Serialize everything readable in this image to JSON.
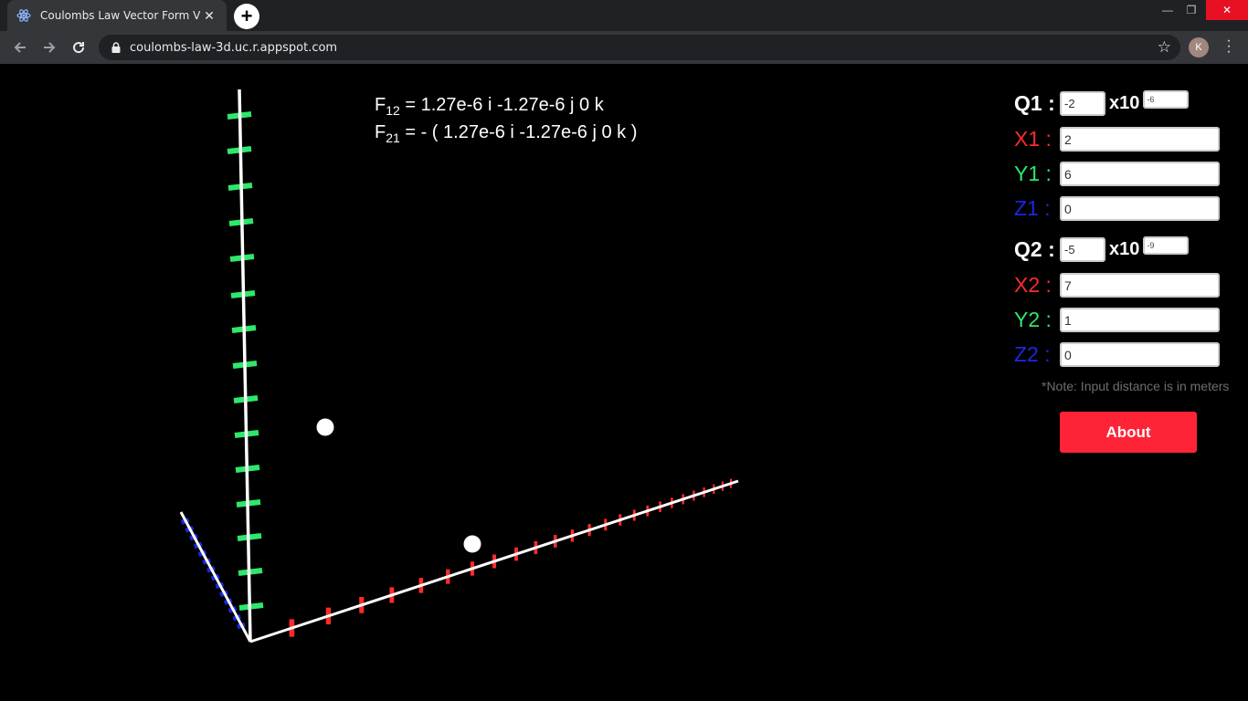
{
  "browser": {
    "tab_title": "Coulombs Law Vector Form Visua",
    "tab_close": "✕",
    "new_tab": "+",
    "url": "coulombs-law-3d.uc.r.appspot.com",
    "avatar_letter": "K",
    "window_controls": {
      "minimize": "—",
      "restore": "❐",
      "close": "✕"
    }
  },
  "forces": {
    "f12_symbol": "F",
    "f12_sub": "12",
    "f12_text": " = 1.27e-6 i -1.27e-6 j 0 k",
    "f21_symbol": "F",
    "f21_sub": "21",
    "f21_text": " = - ( 1.27e-6 i -1.27e-6 j 0 k )"
  },
  "panel": {
    "q1_label": "Q1 :",
    "q1_value": "-2",
    "q1_x10": "x10",
    "q1_exp": "-6",
    "x1_label": "X1 :",
    "x1_value": "2",
    "y1_label": "Y1 :",
    "y1_value": "6",
    "z1_label": "Z1 :",
    "z1_value": "0",
    "q2_label": "Q2 :",
    "q2_value": "-5",
    "q2_x10": "x10",
    "q2_exp": "-9",
    "x2_label": "X2 :",
    "x2_value": "7",
    "y2_label": "Y2 :",
    "y2_value": "1",
    "z2_label": "Z2 :",
    "z2_value": "0",
    "note": "*Note: Input distance is in meters",
    "about_label": "About"
  },
  "colors": {
    "x_axis_ticks": "#ff2b2b",
    "y_axis_ticks": "#2ee86b",
    "z_axis_ticks": "#1a28e0",
    "axes": "#ffffff",
    "charges": "#ffffff",
    "about_button": "#ff2337"
  }
}
